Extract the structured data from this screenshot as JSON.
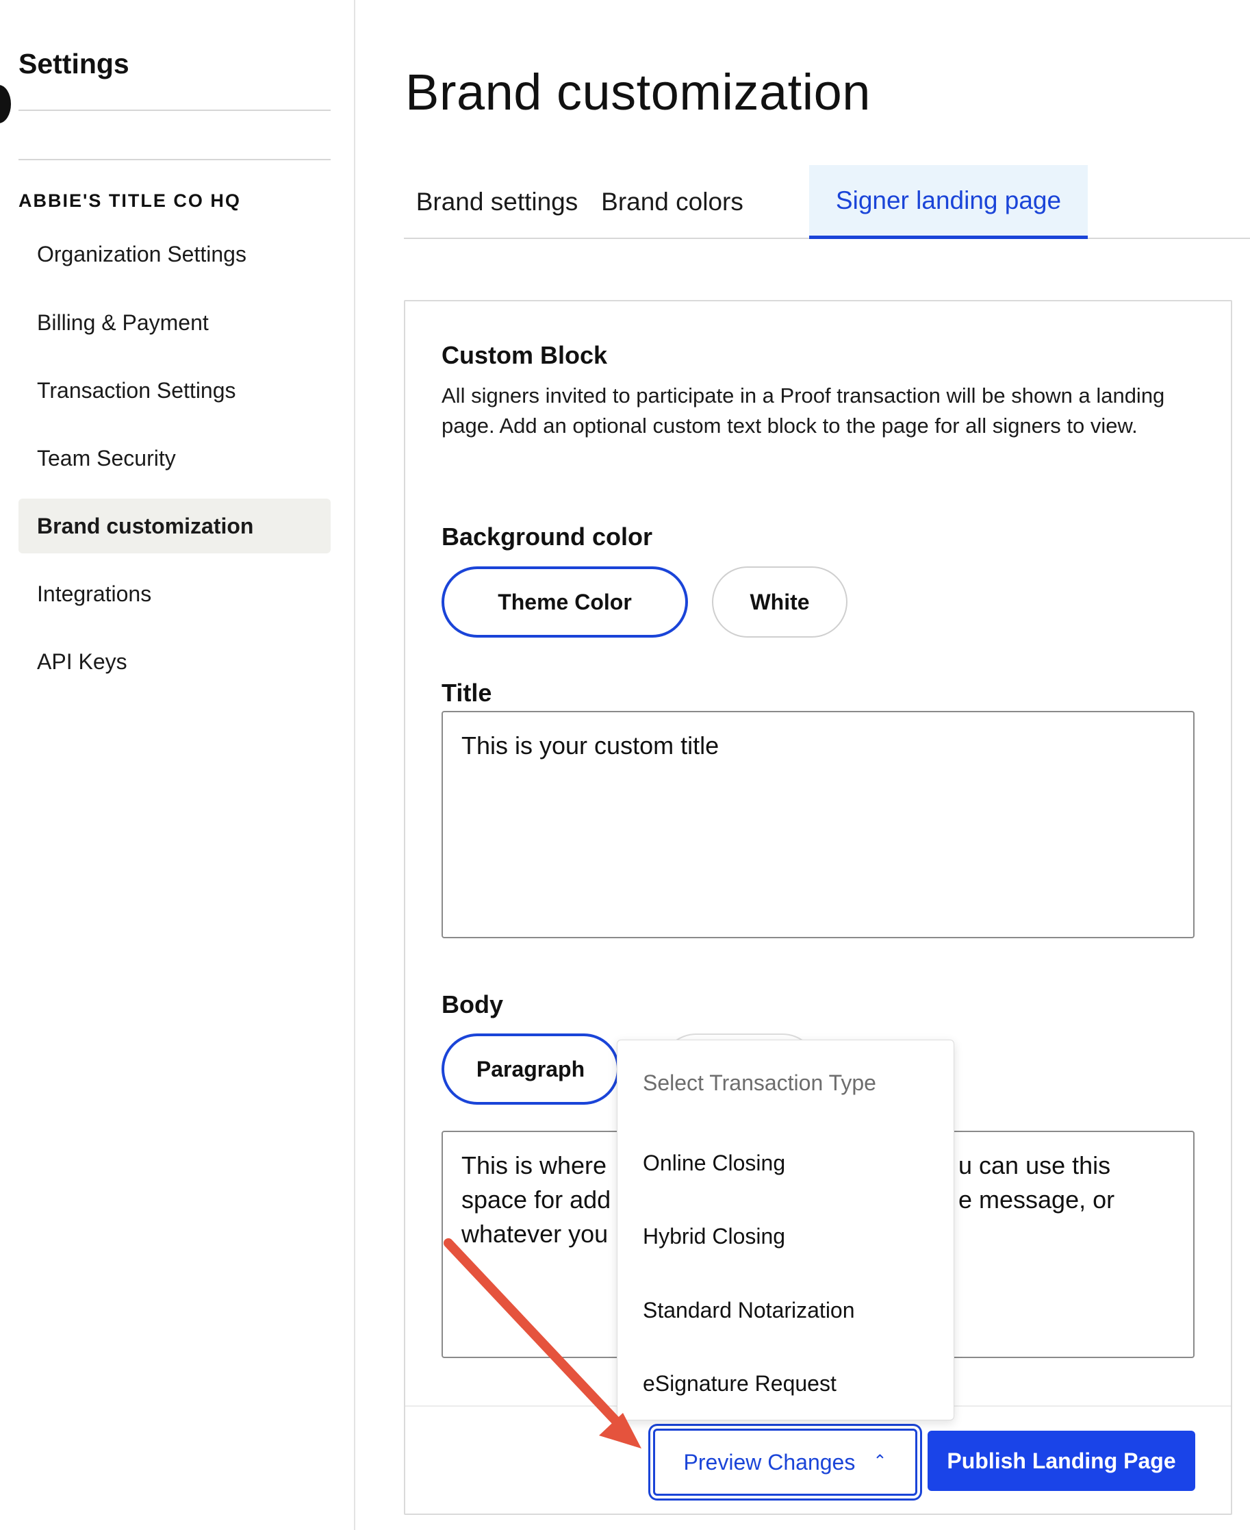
{
  "sidebar": {
    "title": "Settings",
    "org_name": "ABBIE'S TITLE CO HQ",
    "items": [
      {
        "label": "Organization Settings"
      },
      {
        "label": "Billing & Payment"
      },
      {
        "label": "Transaction Settings"
      },
      {
        "label": "Team Security"
      },
      {
        "label": "Brand customization",
        "active": true
      },
      {
        "label": "Integrations"
      },
      {
        "label": "API Keys"
      }
    ]
  },
  "main": {
    "title": "Brand customization",
    "tabs": [
      {
        "label": "Brand settings"
      },
      {
        "label": "Brand colors"
      },
      {
        "label": "Signer landing page",
        "active": true
      }
    ],
    "custom_block": {
      "heading": "Custom Block",
      "description": "All signers invited to participate in a Proof transaction will be shown a landing page. Add an optional custom text block to the page for all signers to view."
    },
    "background_color": {
      "heading": "Background color",
      "options": [
        {
          "label": "Theme Color",
          "selected": true
        },
        {
          "label": "White",
          "selected": false
        }
      ]
    },
    "title_field": {
      "heading": "Title",
      "value": "This is your custom title"
    },
    "body_field": {
      "heading": "Body",
      "format_options": [
        {
          "label": "Paragraph",
          "selected": true
        }
      ],
      "value_left": "This is where\nspace for add\nwhatever you",
      "value_right": "u can use this\ne message, or"
    },
    "actions": {
      "preview_label": "Preview Changes",
      "publish_label": "Publish Landing Page"
    },
    "dropdown": {
      "header": "Select Transaction Type",
      "options": [
        "Online Closing",
        "Hybrid Closing",
        "Standard Notarization",
        "eSignature Request"
      ]
    }
  },
  "colors": {
    "accent": "#1a44d8",
    "publish_bg": "#1a44e8",
    "active_tab_bg": "#eaf4fc",
    "active_sidebar_bg": "#f0f0ec",
    "annotation_arrow": "#e5533d"
  },
  "icons": {
    "preview_chevron": "chevron-up-icon"
  }
}
